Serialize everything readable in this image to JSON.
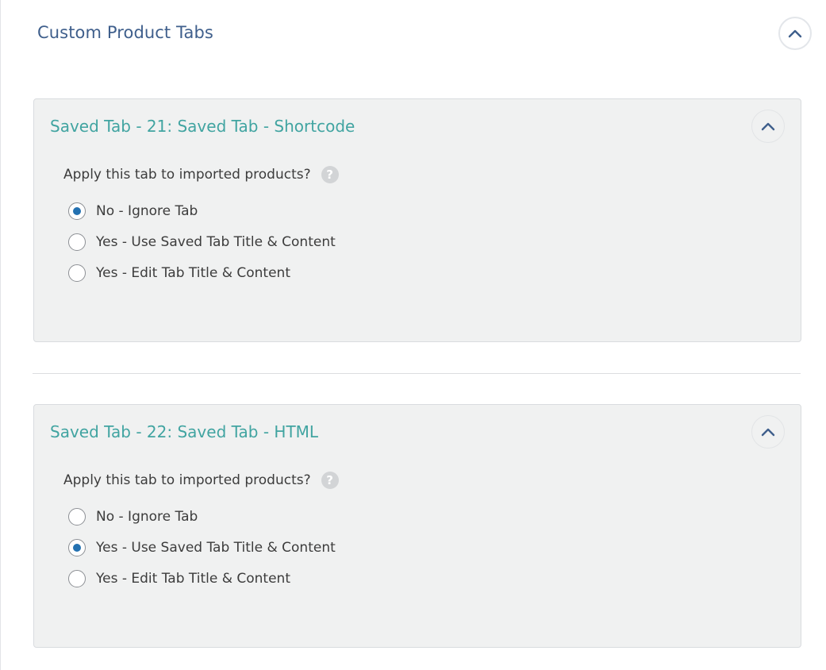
{
  "section": {
    "title": "Custom Product Tabs",
    "toggle_icon": "chevron-up-icon"
  },
  "colors": {
    "section_title": "#3f5f8c",
    "tab_title": "#41a4a1",
    "radio_checked": "#2371b1",
    "panel_bg": "#f0f1f1"
  },
  "tabs": [
    {
      "title": "Saved Tab - 21: Saved Tab - Shortcode",
      "question": "Apply this tab to imported products?",
      "help_icon": "?",
      "options": [
        {
          "label": "No - Ignore Tab",
          "checked": true
        },
        {
          "label": "Yes - Use Saved Tab Title & Content",
          "checked": false
        },
        {
          "label": "Yes - Edit Tab Title & Content",
          "checked": false
        }
      ]
    },
    {
      "title": "Saved Tab - 22: Saved Tab - HTML",
      "question": "Apply this tab to imported products?",
      "help_icon": "?",
      "options": [
        {
          "label": "No - Ignore Tab",
          "checked": false
        },
        {
          "label": "Yes - Use Saved Tab Title & Content",
          "checked": true
        },
        {
          "label": "Yes - Edit Tab Title & Content",
          "checked": false
        }
      ]
    }
  ]
}
